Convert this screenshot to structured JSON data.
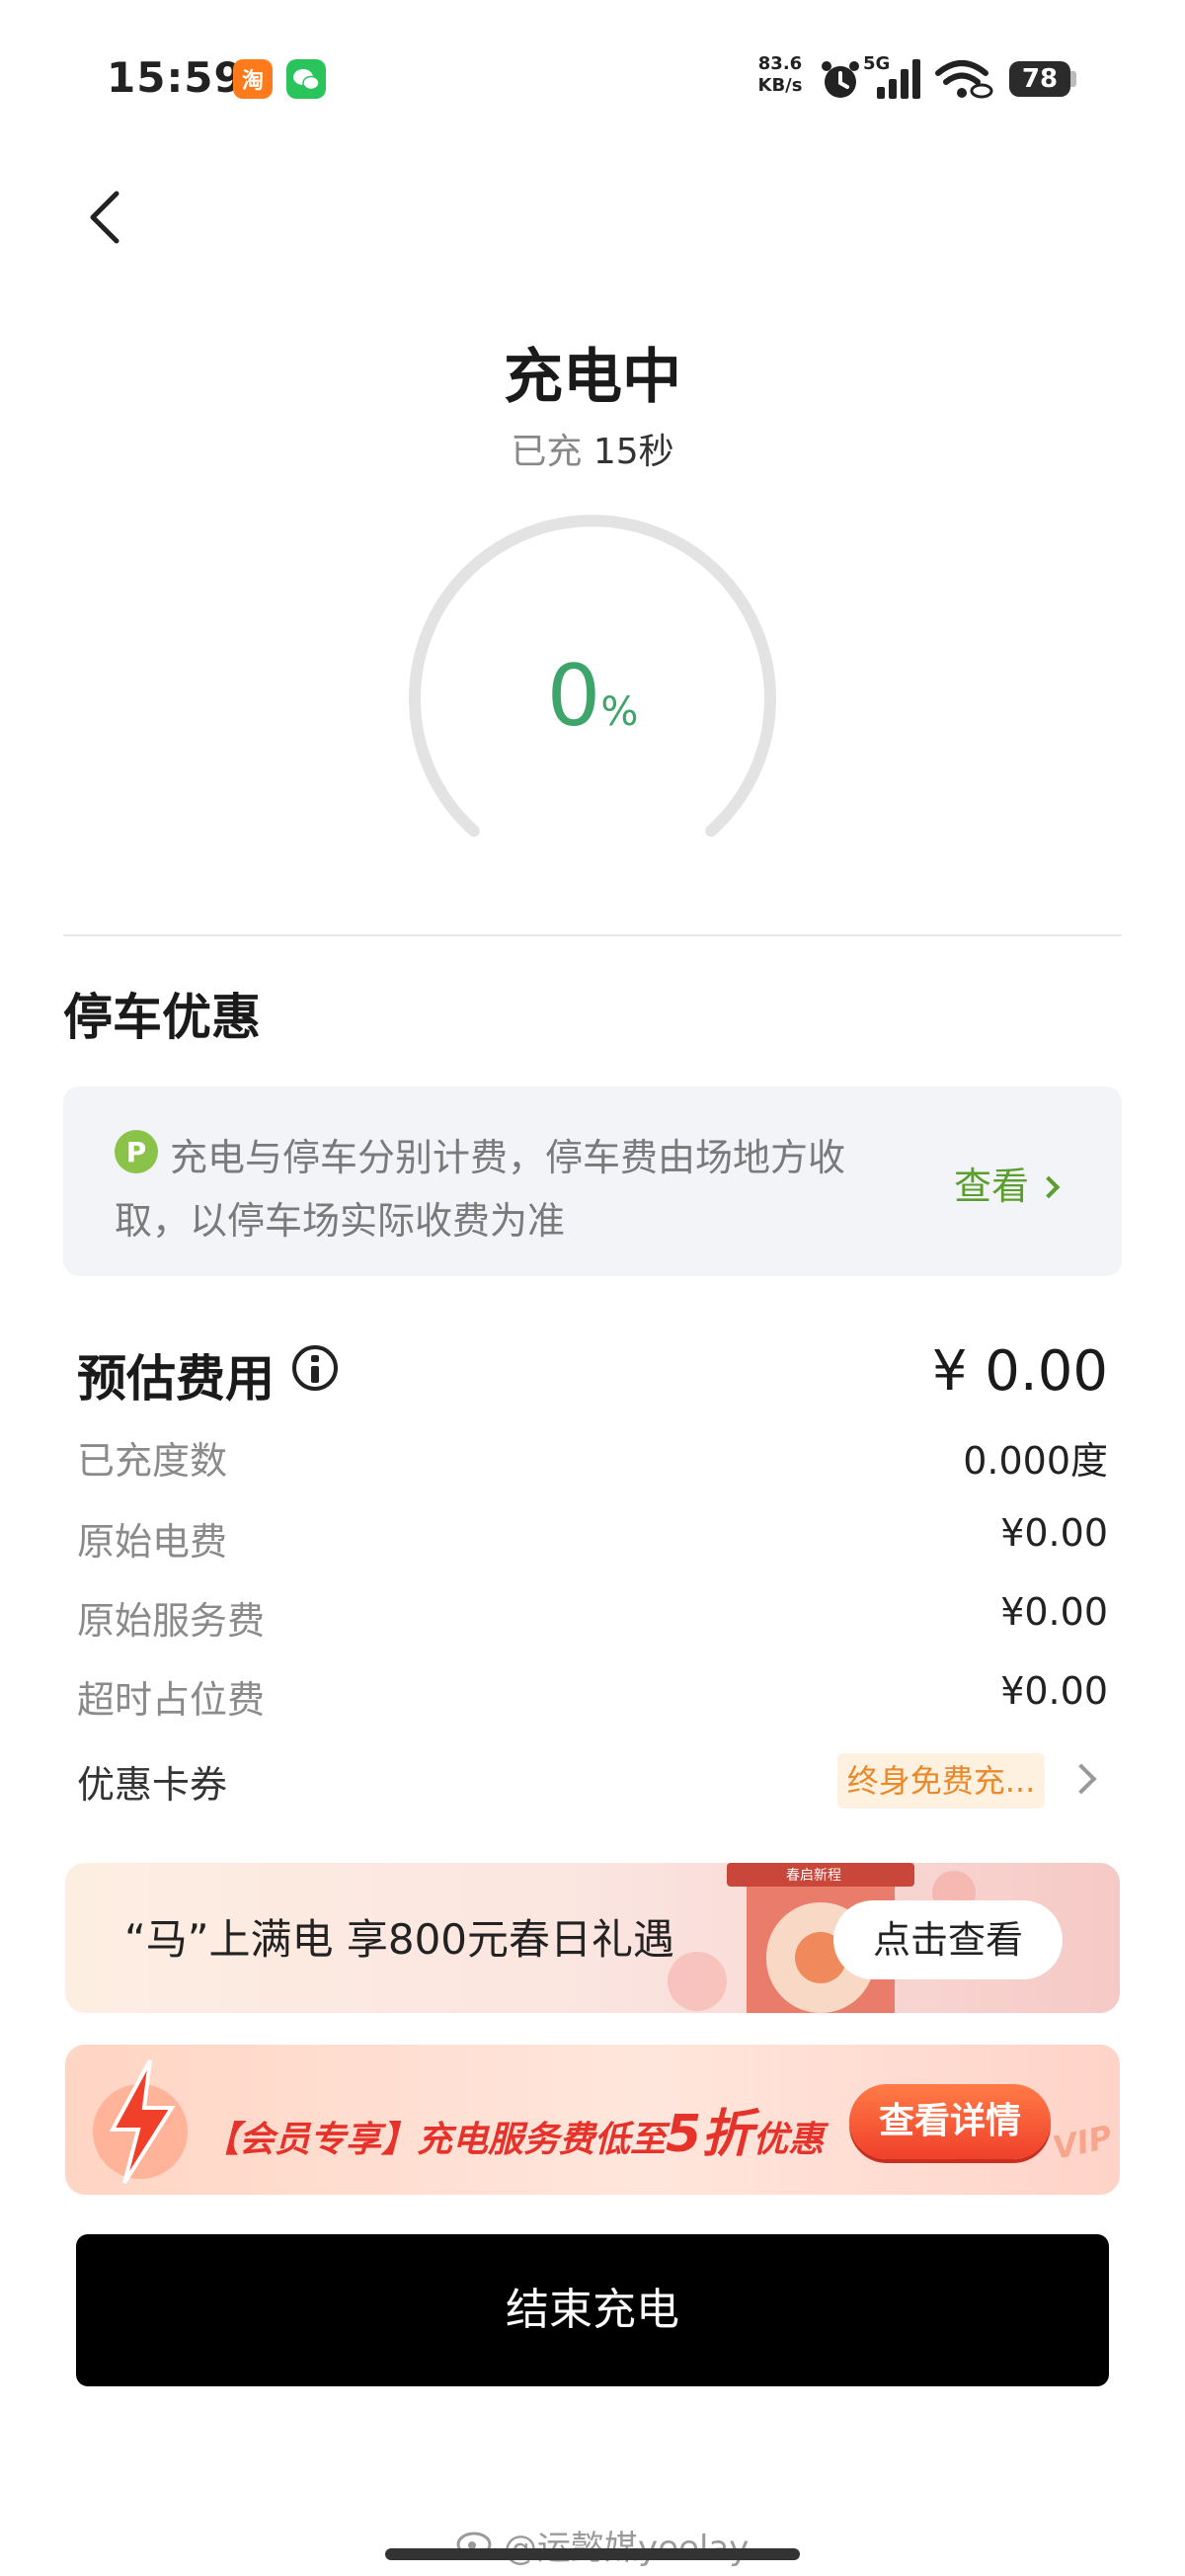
{
  "status_bar": {
    "time": "15:59",
    "net_speed_value": "83.6",
    "net_speed_unit": "KB/s",
    "network_type": "5G",
    "battery": "78",
    "app_icons": [
      "taobao-icon",
      "wechat-icon"
    ],
    "icons": [
      "alarm-icon",
      "signal-icon",
      "wifi-icon",
      "battery-icon"
    ]
  },
  "nav": {
    "back_icon": "chevron-left-icon"
  },
  "header": {
    "title": "充电中",
    "elapsed_prefix": "已充",
    "elapsed_value": "15秒"
  },
  "gauge": {
    "value": "0",
    "unit": "%",
    "progress": 0,
    "accent": "#3da46a"
  },
  "parking": {
    "title": "停车优惠",
    "icon_letter": "P",
    "text": "充电与停车分别计费，停车费由场地方收取，以停车场实际收费为准",
    "link": "查看"
  },
  "fees": {
    "title": "预估费用",
    "total": "¥ 0.00",
    "rows": [
      {
        "label": "已充度数",
        "value": "0.000度"
      },
      {
        "label": "原始电费",
        "value": "¥0.00"
      },
      {
        "label": "原始服务费",
        "value": "¥0.00"
      },
      {
        "label": "超时占位费",
        "value": "¥0.00"
      }
    ],
    "coupon_label": "优惠卡券",
    "coupon_value": "终身免费充..."
  },
  "banner1": {
    "text": "“马”上满电 享800元春日礼遇",
    "button": "点击查看",
    "deco_text": "春启新程"
  },
  "banner2": {
    "text_prefix": "【会员专享】充电服务费低至",
    "text_big": "5折",
    "text_suffix": "优惠",
    "button": "查看详情",
    "badge": "VIP"
  },
  "end_button": "结束充电",
  "watermark": "@运懿媒yeelay",
  "colors": {
    "accent_green": "#3da46a",
    "link_green": "#5a9e2e",
    "coupon_orange": "#e8892c",
    "promo_red": "#e5322a"
  }
}
